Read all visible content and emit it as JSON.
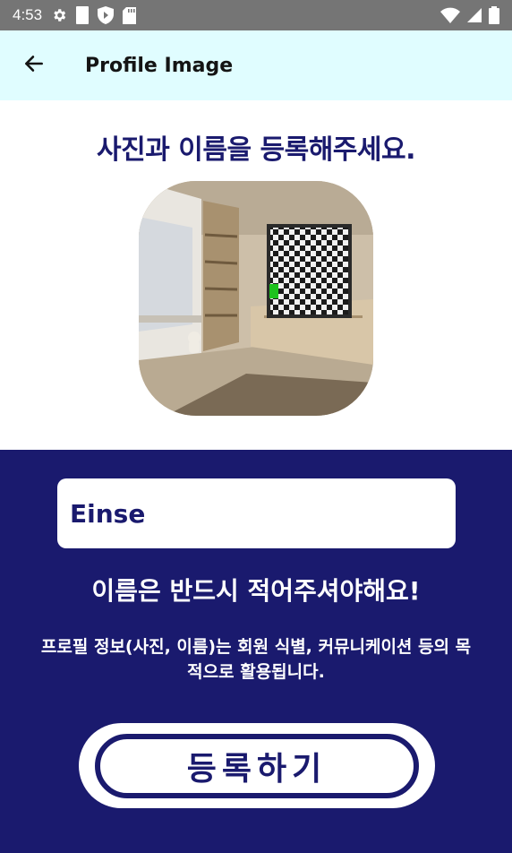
{
  "status_bar": {
    "time": "4:53",
    "left_icons": [
      "settings-icon",
      "sim-card-icon",
      "shield-play-icon",
      "sd-card-icon"
    ],
    "right_icons": [
      "wifi-icon",
      "signal-icon",
      "battery-icon"
    ]
  },
  "app_bar": {
    "back_icon": "arrow-left-icon",
    "title": "Profile Image"
  },
  "main": {
    "heading": "사진과 이름을 등록해주세요.",
    "profile_image": "profile-photo"
  },
  "form": {
    "name_value": "Einse",
    "name_placeholder": "",
    "warning": "이름은 반드시 적어주셔야해요!",
    "notice": "프로필 정보(사진, 이름)는 회원 식별, 커뮤니케이션 등의 목적으로 활용됩니다.",
    "register_label": "등록하기"
  },
  "colors": {
    "status_bar": "#757575",
    "app_bar": "#e0fdff",
    "primary": "#1a1a6e",
    "background": "#ffffff"
  }
}
